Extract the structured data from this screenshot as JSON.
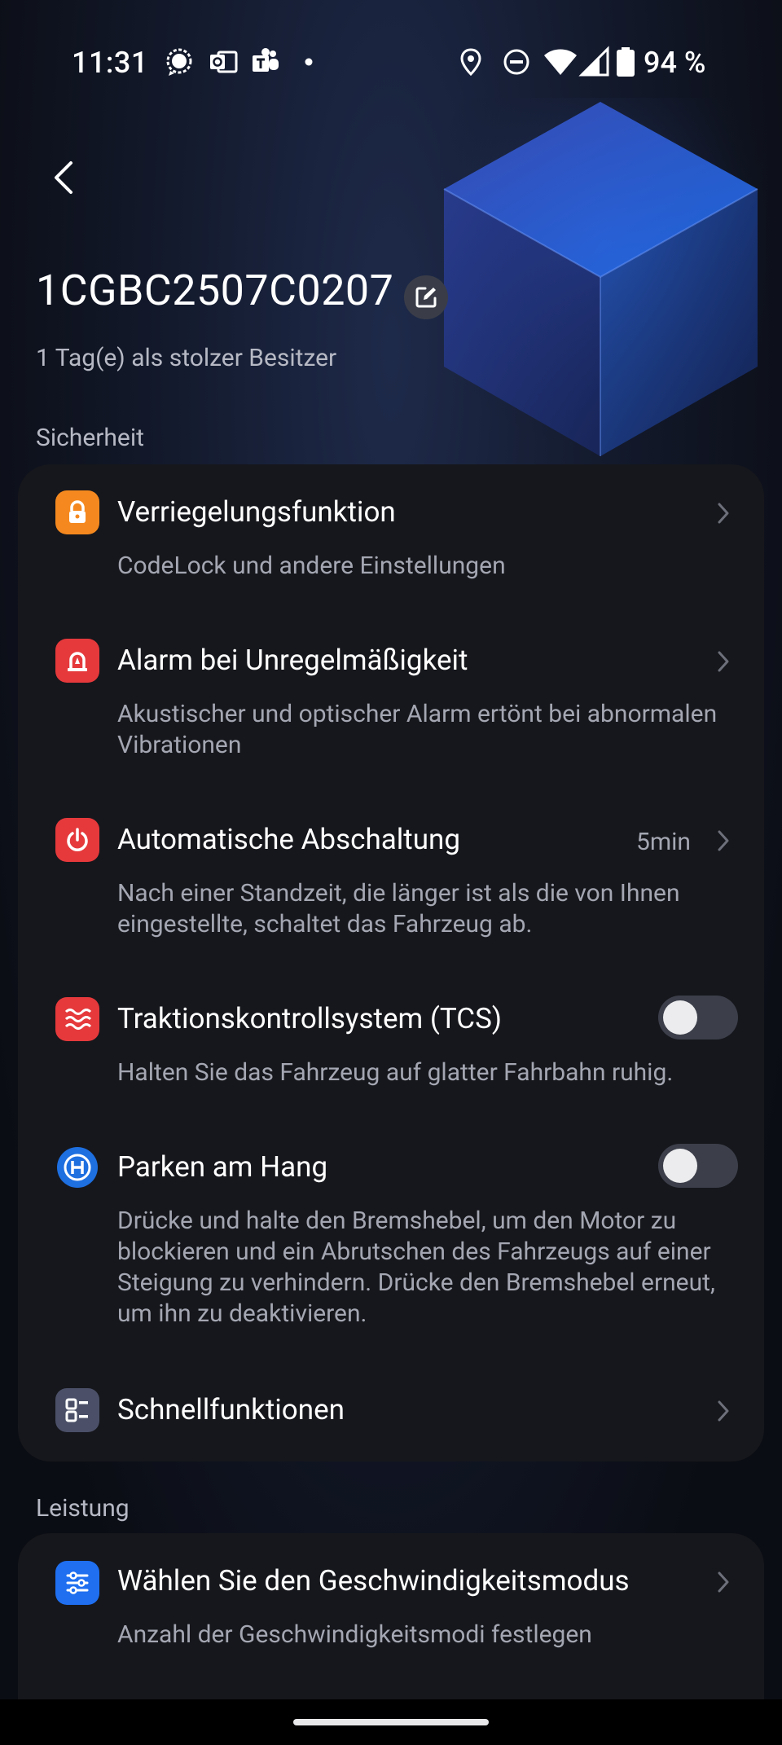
{
  "status_bar": {
    "time": "11:31",
    "battery": "94 %",
    "left_icons": [
      "signal-messenger-icon",
      "outlook-icon",
      "teams-icon",
      "dot-icon"
    ],
    "right_icons": [
      "location-icon",
      "do-not-disturb-icon",
      "wifi-icon",
      "cellular-icon",
      "battery-icon"
    ]
  },
  "header": {
    "device_name": "1CGBC2507C0207",
    "owner_text": "1 Tag(e) als stolzer Besitzer"
  },
  "sections": {
    "security_label": "Sicherheit",
    "performance_label": "Leistung"
  },
  "security_items": [
    {
      "title": "Verriegelungsfunktion",
      "description": "CodeLock und andere Einstellungen",
      "icon": "lock-icon",
      "icon_color": "#f5891f"
    },
    {
      "title": "Alarm bei Unregelmäßigkeit",
      "description": "Akustischer und optischer Alarm ertönt bei abnormalen Vibrationen",
      "icon": "alarm-icon",
      "icon_color": "#e5393c"
    },
    {
      "title": "Automatische Abschaltung",
      "value": "5min",
      "description": "Nach einer Standzeit, die länger ist als die von Ihnen eingestellte, schaltet das Fahrzeug ab.",
      "icon": "power-icon",
      "icon_color": "#e5393c"
    },
    {
      "title": "Traktionskontrollsystem (TCS)",
      "description": "Halten Sie das Fahrzeug auf glatter Fahrbahn ruhig.",
      "icon": "traction-icon",
      "icon_color": "#e5393c",
      "enabled": false
    },
    {
      "title": "Parken am Hang",
      "description": "Drücke und halte den Bremshebel, um den Motor zu blockieren und ein Abrutschen des Fahrzeugs auf einer Steigung zu verhindern. Drücke den Bremshebel erneut, um ihn zu deaktivieren.",
      "icon": "hill-hold-icon",
      "icon_color": "#1e6fe0",
      "enabled": false
    },
    {
      "title": "Schnellfunktionen",
      "icon": "quick-functions-icon",
      "icon_color": "#4b5068"
    }
  ],
  "performance_items": [
    {
      "title": "Wählen Sie den Geschwindigkeitsmodus",
      "description": "Anzahl der Geschwindigkeitsmodi festlegen",
      "icon": "sliders-icon",
      "icon_color": "#1f6ff0"
    }
  ],
  "colors": {
    "card_background": "#16171c",
    "toggle_off": "#3c3f4a",
    "accent_blue": "#1f6ff0",
    "accent_red": "#e5393c",
    "accent_orange": "#f5891f"
  }
}
